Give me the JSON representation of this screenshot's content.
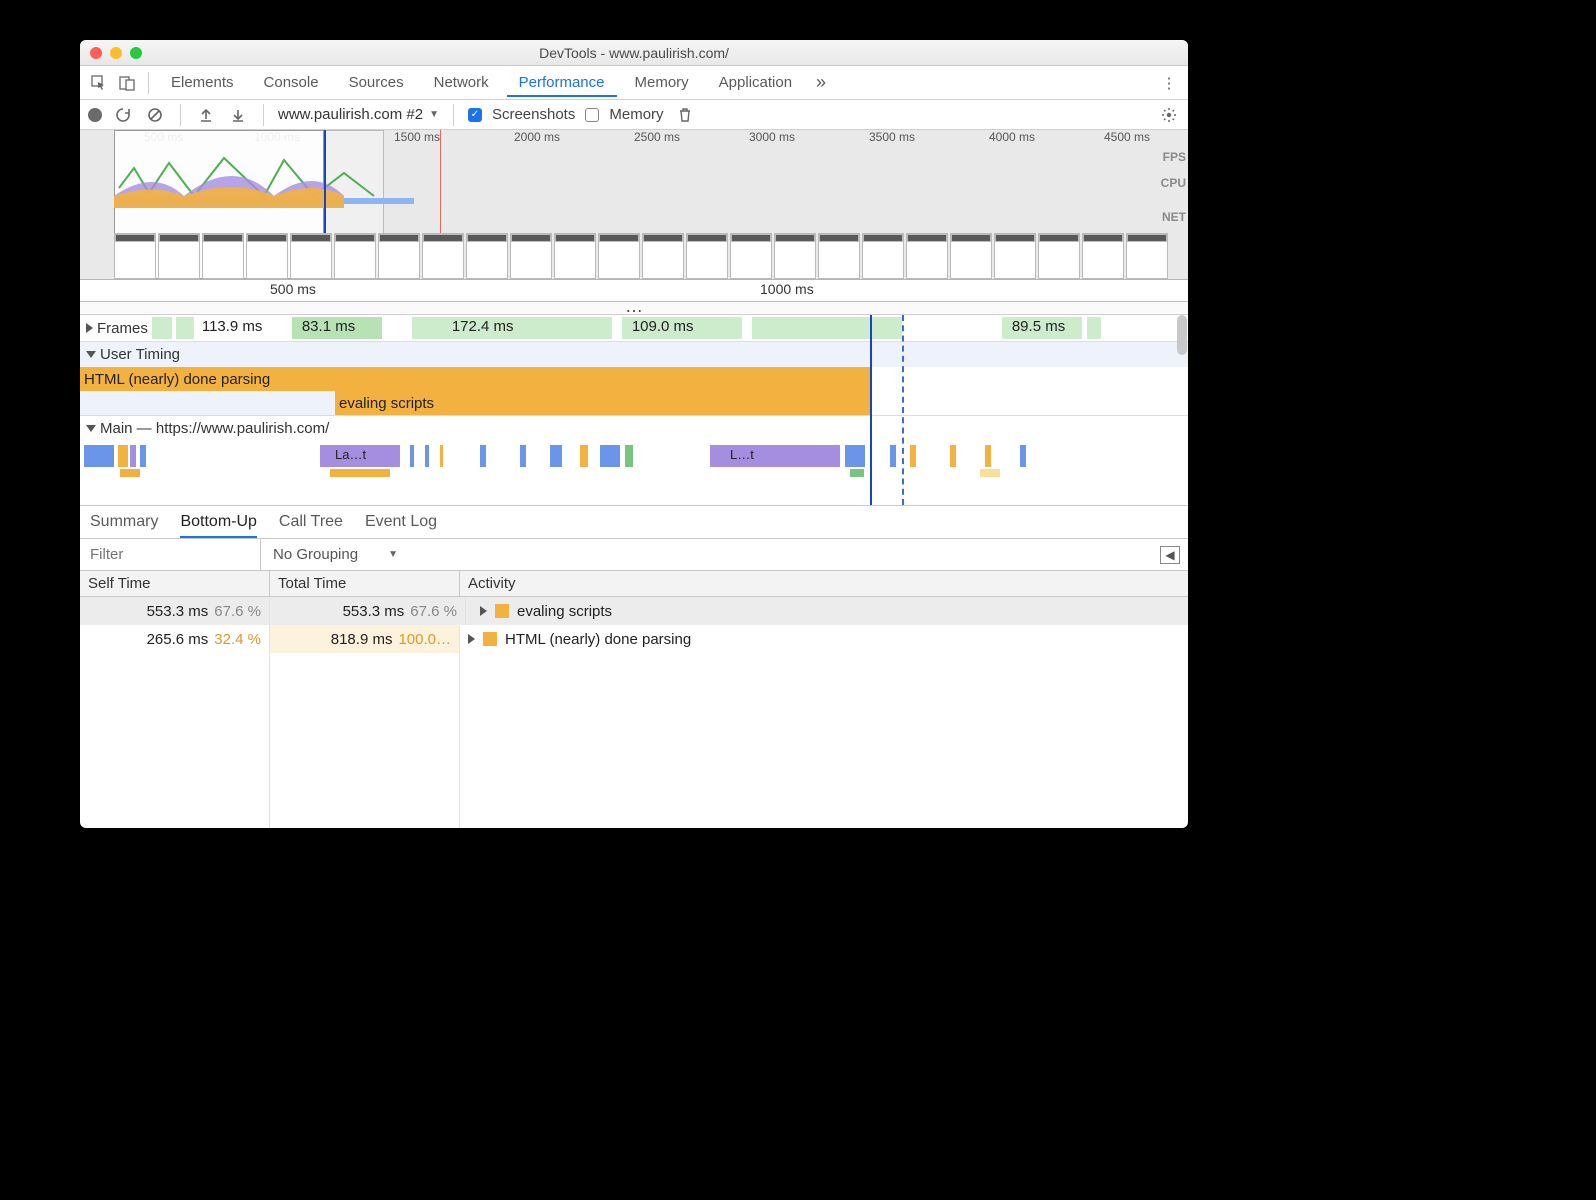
{
  "window": {
    "title": "DevTools - www.paulirish.com/"
  },
  "tabs": {
    "items": [
      "Elements",
      "Console",
      "Sources",
      "Network",
      "Performance",
      "Memory",
      "Application"
    ],
    "active": "Performance",
    "more_glyph": "»"
  },
  "toolbar": {
    "recording_select": "www.paulirish.com #2",
    "screenshots_label": "Screenshots",
    "screenshots_checked": true,
    "memory_label": "Memory",
    "memory_checked": false
  },
  "overview": {
    "ticks": [
      "500 ms",
      "1000 ms",
      "1500 ms",
      "2000 ms",
      "2500 ms",
      "3000 ms",
      "3500 ms",
      "4000 ms",
      "4500 ms"
    ],
    "side_labels": [
      "FPS",
      "CPU",
      "NET"
    ]
  },
  "ruler": {
    "ticks": [
      "500 ms",
      "1000 ms"
    ]
  },
  "frames": {
    "label": "Frames",
    "values": [
      "113.9 ms",
      "83.1 ms",
      "172.4 ms",
      "109.0 ms",
      "89.5 ms"
    ]
  },
  "user_timing": {
    "label": "User Timing",
    "bars": [
      "HTML (nearly) done parsing",
      "evaling scripts"
    ]
  },
  "main": {
    "label": "Main — https://www.paulirish.com/",
    "chips": [
      "La…t",
      "L…t"
    ]
  },
  "bottom_tabs": {
    "items": [
      "Summary",
      "Bottom-Up",
      "Call Tree",
      "Event Log"
    ],
    "active": "Bottom-Up"
  },
  "filter": {
    "placeholder": "Filter",
    "grouping": "No Grouping"
  },
  "table": {
    "headers": [
      "Self Time",
      "Total Time",
      "Activity"
    ],
    "rows": [
      {
        "self_ms": "553.3 ms",
        "self_pct": "67.6 %",
        "total_ms": "553.3 ms",
        "total_pct": "67.6 %",
        "activity": "evaling scripts",
        "selected": true
      },
      {
        "self_ms": "265.6 ms",
        "self_pct": "32.4 %",
        "total_ms": "818.9 ms",
        "total_pct": "100.0…",
        "activity": "HTML (nearly) done parsing",
        "selected": false
      }
    ]
  }
}
